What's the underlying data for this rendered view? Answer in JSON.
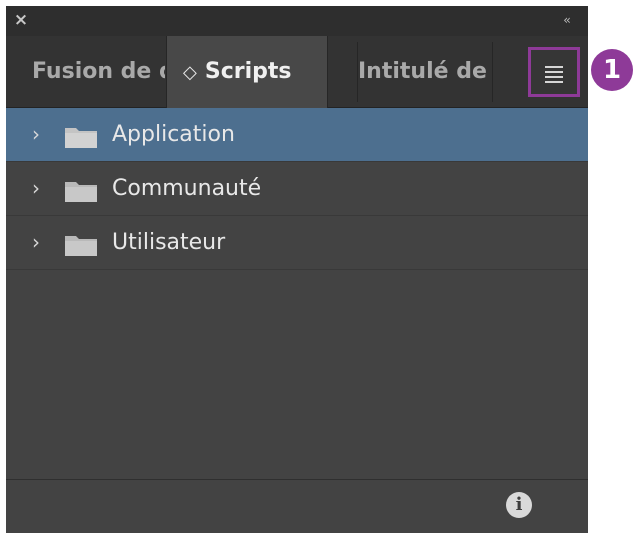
{
  "window": {
    "close_glyph": "×",
    "collapse_glyph": "‹‹"
  },
  "tabs": [
    {
      "label": "Fusion de données",
      "active": false
    },
    {
      "label": "Scripts",
      "active": true,
      "prefix_glyph": "◇"
    },
    {
      "label": "Intitulé de script",
      "active": false
    }
  ],
  "panel_menu": {
    "icon": "hamburger-menu-icon"
  },
  "folders": [
    {
      "label": "Application",
      "selected": true
    },
    {
      "label": "Communauté",
      "selected": false
    },
    {
      "label": "Utilisateur",
      "selected": false
    }
  ],
  "expand_glyph": "›",
  "footer": {
    "info_glyph": "i"
  },
  "callout": {
    "number": "1"
  },
  "colors": {
    "selected_row": "#4d6f8f",
    "callout": "#8e3a98",
    "panel_bg": "#434343"
  }
}
